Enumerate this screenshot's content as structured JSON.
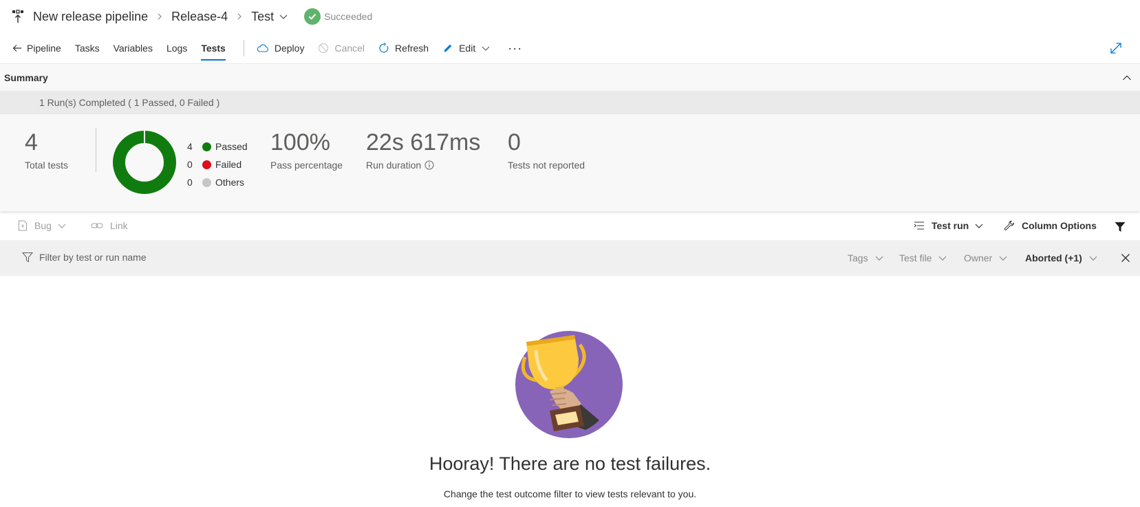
{
  "header": {
    "pipeline_name": "New release pipeline",
    "release_name": "Release-4",
    "stage_name": "Test",
    "status": "Succeeded",
    "status_color": "#5fb36b"
  },
  "toolbar": {
    "tabs": [
      "Pipeline",
      "Tasks",
      "Variables",
      "Logs",
      "Tests"
    ],
    "active_tab": "Tests",
    "deploy": "Deploy",
    "cancel": "Cancel",
    "refresh": "Refresh",
    "edit": "Edit",
    "more": "···"
  },
  "summary": {
    "title": "Summary",
    "runs_text": "1 Run(s) Completed ( 1 Passed, 0 Failed )",
    "total_tests": "4",
    "total_tests_label": "Total tests",
    "legend": [
      {
        "count": "4",
        "label": "Passed",
        "color": "#107c10"
      },
      {
        "count": "0",
        "label": "Failed",
        "color": "#e00b1c"
      },
      {
        "count": "0",
        "label": "Others",
        "color": "#c8c6c4"
      }
    ],
    "pass_percentage": "100%",
    "pass_percentage_label": "Pass percentage",
    "run_duration": "22s 617ms",
    "run_duration_label": "Run duration",
    "not_reported": "0",
    "not_reported_label": "Tests not reported"
  },
  "actions": {
    "bug": "Bug",
    "link": "Link",
    "test_run": "Test run",
    "column_options": "Column Options"
  },
  "filters": {
    "placeholder": "Filter by test or run name",
    "tags": "Tags",
    "test_file": "Test file",
    "owner": "Owner",
    "outcome": "Aborted (+1)"
  },
  "empty_state": {
    "title": "Hooray! There are no test failures.",
    "subtitle": "Change the test outcome filter to view tests relevant to you."
  }
}
